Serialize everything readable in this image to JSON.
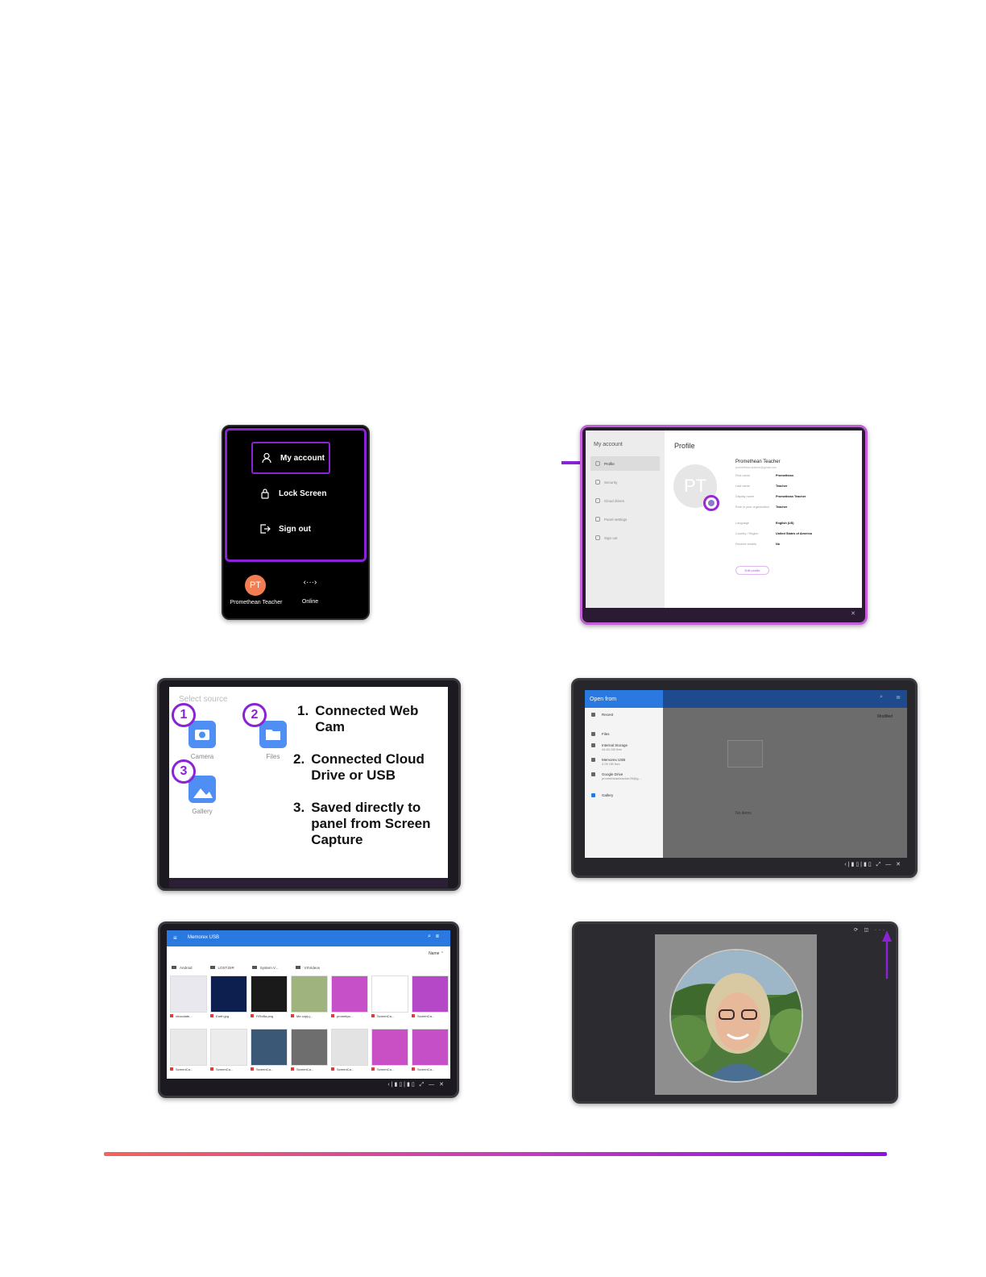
{
  "panel1": {
    "menu_items": [
      "My account",
      "Lock Screen",
      "Sign out"
    ],
    "avatar_initials": "PT",
    "user_name": "Promethean Teacher",
    "status_label": "Online"
  },
  "panel2": {
    "sidebar_header": "My account",
    "sidebar_items": [
      "Profile",
      "Security",
      "Cloud drives",
      "Panel settings",
      "Sign out"
    ],
    "title": "Profile",
    "avatar_initials": "PT",
    "display_name": "Promethean Teacher",
    "email": "promethean.teacher@gmail.com",
    "fields": [
      {
        "label": "First name",
        "value": "Promethean"
      },
      {
        "label": "Last name",
        "value": "Teacher"
      },
      {
        "label": "Display name",
        "value": "Promethean Teacher"
      },
      {
        "label": "Role in your organization",
        "value": "Teacher"
      },
      {
        "label": "Language",
        "value": "English (US)"
      },
      {
        "label": "Country / Region",
        "value": "United States of America"
      },
      {
        "label": "Receive emails",
        "value": "No"
      }
    ],
    "edit_button": "Edit profile"
  },
  "panel3": {
    "title": "Select source",
    "sources": [
      "Camera",
      "Files",
      "Gallery"
    ],
    "badges": [
      "1",
      "2",
      "3"
    ],
    "list": [
      {
        "n": "1.",
        "text": "Connected Web Cam"
      },
      {
        "n": "2.",
        "text": "Connected Cloud Drive or USB"
      },
      {
        "n": "3.",
        "text": "Saved directly to panel from Screen Capture"
      }
    ]
  },
  "panel4": {
    "title": "Open from",
    "sort_label": "Modified",
    "nav_items": [
      {
        "label": "Recent",
        "sub": ""
      },
      {
        "label": "Files",
        "sub": ""
      },
      {
        "label": "Internal Storage",
        "sub": "44.84 GB free"
      },
      {
        "label": "Memorex USB",
        "sub": "3.09 GB free"
      },
      {
        "label": "Google Drive",
        "sub": "prometheanteacher29@g..."
      },
      {
        "label": "Gallery",
        "sub": ""
      }
    ],
    "empty_label": "No items"
  },
  "panel5": {
    "title": "Memorex USB",
    "sort_label": "Name",
    "folders": [
      "Android",
      "LOST.DIR",
      "System V...",
      "VSVideos"
    ],
    "files": [
      "chocolate...",
      "Earth.jpg",
      "FiRoBa.png",
      "Me copy.j...",
      "prometpo...",
      "ScreenCa...",
      "ScreenCa...",
      "ScreenCa...",
      "ScreenCa...",
      "ScreenCa...",
      "ScreenCa...",
      "ScreenCa...",
      "ScreenCa...",
      "ScreenCa..."
    ],
    "thumb_colors": [
      "#e8e8ee",
      "#0c1f4e",
      "#1a1a1a",
      "#9fb37e",
      "#c650c8",
      "#ffffff",
      "#b548c6",
      "#e9e9e9",
      "#ececec",
      "#3b5877",
      "#6e6e6e",
      "#e3e3e3",
      "#c850c4",
      "#c54fc7"
    ]
  },
  "colors": {
    "accent_purple": "#8a22d6",
    "avatar_orange": "#f27d52",
    "tile_blue": "#4f8ef2",
    "header_blue": "#2a79e0"
  }
}
